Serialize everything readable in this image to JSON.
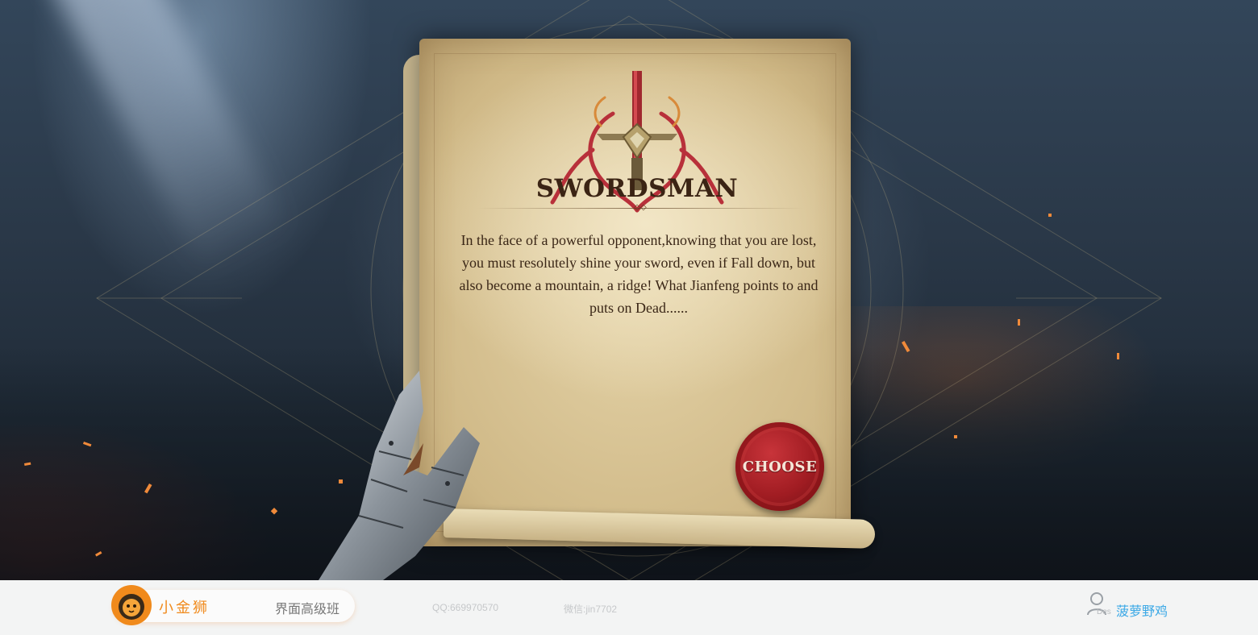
{
  "card": {
    "class_name": "SWORDSMAN",
    "description": "In the face of a powerful opponent,knowing that you are lost, you must resolutely shine your sword, even if Fall down, but also become a mountain, a ridge! What Jianfeng points to and puts on Dead......",
    "choose_label": "CHOOSE"
  },
  "footer": {
    "brand_name": "小金狮",
    "course": "界面高级班",
    "qq": "QQ:669970570",
    "wechat": "微信:jin7702",
    "user_tag": "Des",
    "author": "菠萝野鸡"
  },
  "colors": {
    "title": "#3b2414",
    "seal": "#a01c22",
    "brand": "#f08a1c",
    "author": "#3aa8e6"
  },
  "icons": [
    "sword-emblem-icon",
    "gauntlet-hand",
    "lion-logo-icon",
    "user-icon"
  ]
}
